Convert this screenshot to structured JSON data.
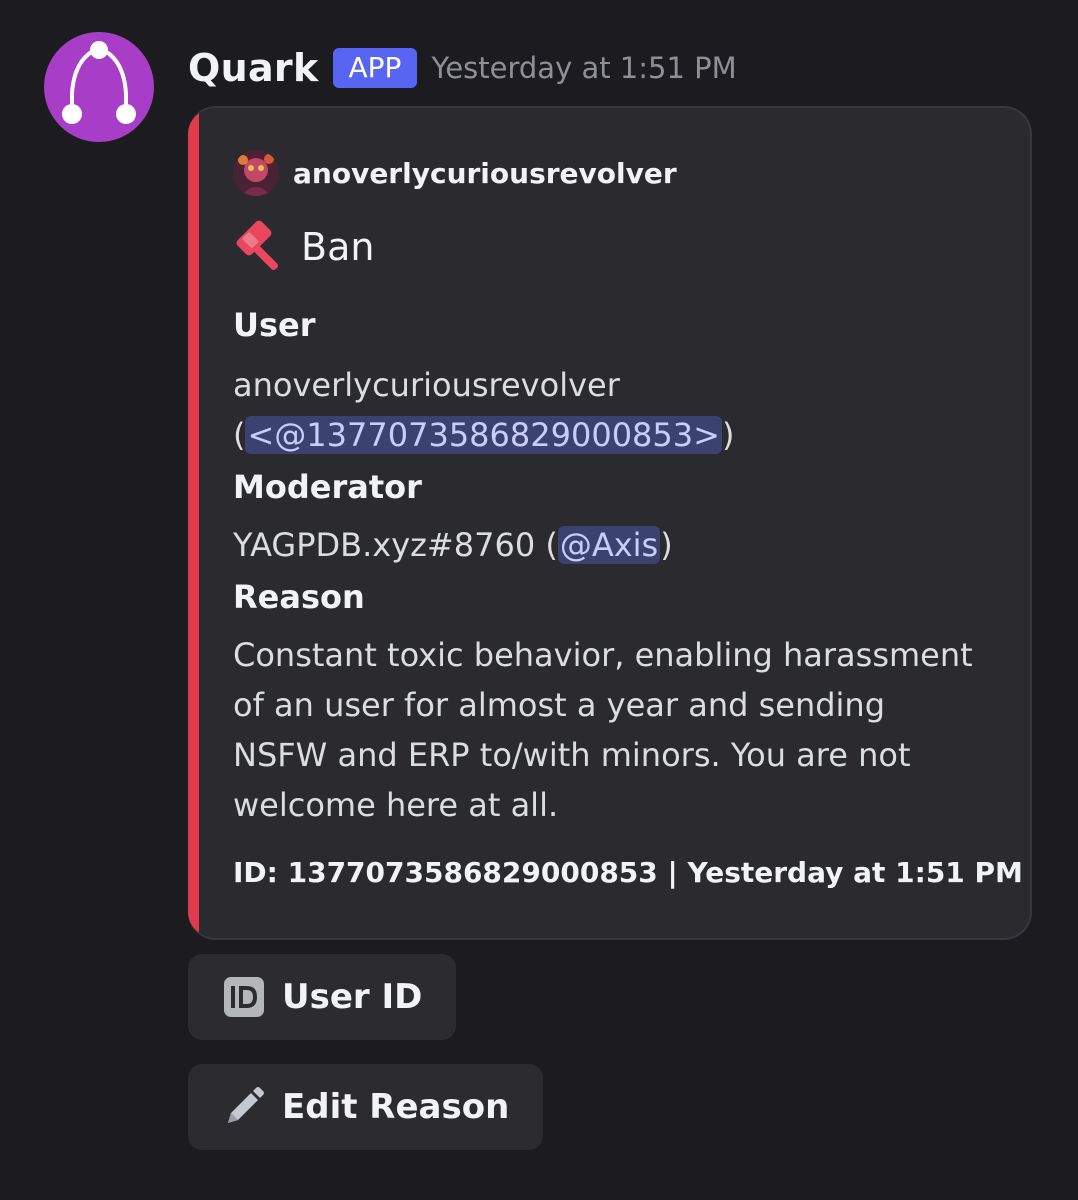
{
  "message": {
    "username": "Quark",
    "badge": "APP",
    "timestamp": "Yesterday at 1:51 PM",
    "colors": {
      "avatar": "#a83dc8",
      "badge": "#5865f2",
      "embed_bar": "#e13a4c"
    }
  },
  "embed": {
    "author": "anoverlycuriousrevolver",
    "title": "Ban",
    "title_icon": "hammer-icon",
    "fields": {
      "user": {
        "name": "User",
        "value_line1": "anoverlycuriousrevolver",
        "open_paren": "(",
        "mention": "<@1377073586829000853>",
        "close_paren": ")"
      },
      "moderator": {
        "name": "Moderator",
        "value_prefix": "YAGPDB.xyz#8760 (",
        "mention": "@Axis",
        "close_paren": ")"
      },
      "reason": {
        "name": "Reason",
        "lines": [
          "Constant toxic behavior, enabling harassment",
          "of an user for almost a year and sending",
          "NSFW and ERP to/with minors. You are not",
          "welcome here at all."
        ]
      }
    },
    "footer": "ID: 1377073586829000853 | Yesterday at 1:51 PM"
  },
  "buttons": {
    "user_id": {
      "label": "User ID",
      "icon": "id-card-icon"
    },
    "edit_reason": {
      "label": "Edit Reason",
      "icon": "pencil-icon"
    }
  }
}
